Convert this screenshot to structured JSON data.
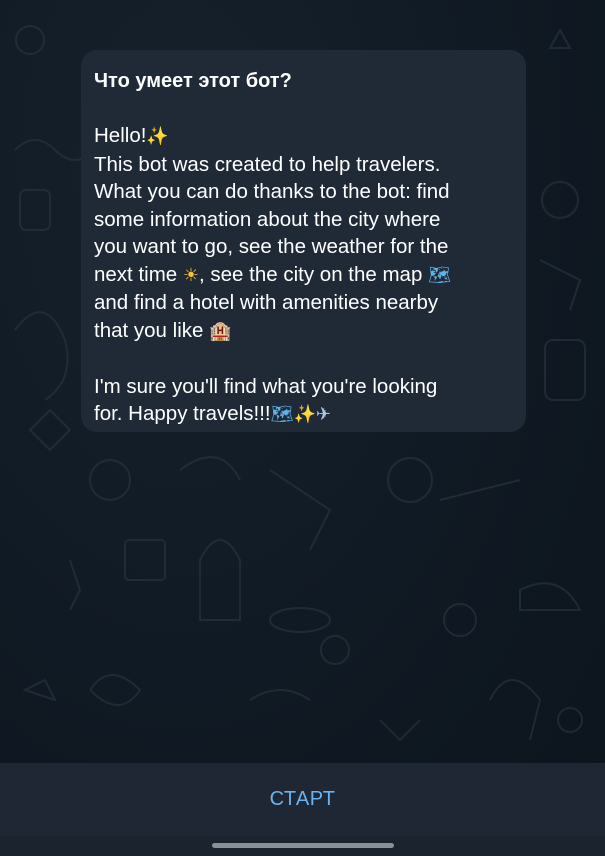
{
  "bot_info": {
    "title": "Что умеет этот бот?",
    "greeting": "Hello!",
    "greeting_icon": "sparkles-emoji",
    "line_1": "This bot was created to help travelers.",
    "line_2": "What you can do thanks to the bot: find",
    "line_3": "some information about the city where",
    "line_4": "you want to go, see the weather for the",
    "line_5_a": "next time ",
    "line_5_icon": "sun-emoji",
    "line_5_b": ", see the city on the map ",
    "line_5_icon_2": "map-emoji",
    "line_6": "and find a hotel with amenities nearby",
    "line_7": "that you like ",
    "line_7_icon": "hotel-emoji",
    "closing_1": "I'm sure you'll find what you're looking",
    "closing_2": "for. Happy travels!!!",
    "closing_icons": [
      "map-emoji",
      "sparkles-emoji",
      "airplane-emoji"
    ]
  },
  "bottom_bar": {
    "start_label": "СТАРТ"
  },
  "colors": {
    "background": "#0e1621",
    "bubble": "#1f2a36",
    "accent": "#6ab2f2",
    "bottom_bar": "#1e2733"
  }
}
